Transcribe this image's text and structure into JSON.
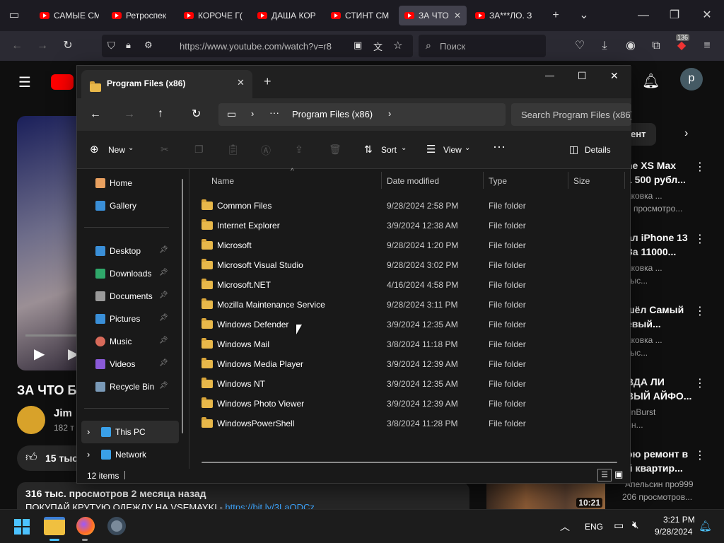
{
  "browser": {
    "tabs": [
      {
        "label": "САМЫЕ СМ"
      },
      {
        "label": "Ретроспек"
      },
      {
        "label": "КОРОЧЕ Г("
      },
      {
        "label": "ДАША КОР"
      },
      {
        "label": "СТИНТ СМ"
      },
      {
        "label": "ЗА ЧТО"
      },
      {
        "label": "ЗА***ЛО. З"
      }
    ],
    "url": "https://www.youtube.com/watch?v=r8",
    "search_placeholder": "Поиск",
    "badge_count": "136"
  },
  "youtube": {
    "avatar_letter": "p",
    "chip": "ент",
    "video_title": "ЗА ЧТО Б",
    "channel_name": "Jim",
    "subscribers": "182 т",
    "likes": "15 тыс",
    "views_line": "316 тыс. просмотров  2 месяца назад",
    "description_line": "ПОКУПАЙ КРУТУЮ ОДЕЖДУ НА VSEMAYKI - ",
    "description_link": "https://bit.ly/3LaQDCz",
    "thumb_duration": "10:21",
    "sidebar": [
      {
        "line1": "ne XS Max",
        "line2": "1 500 рубл...",
        "channel": "аковка ...",
        "meta": "н просмотро..."
      },
      {
        "line1": "ал iPhone 13",
        "line2": "За 11000...",
        "channel": "аковка ...",
        "meta": "тыс..."
      },
      {
        "line1": "шёл Самый",
        "line2": "евый...",
        "channel": "аковка ...",
        "meta": "тыс..."
      },
      {
        "line1": "ВДА ЛИ",
        "line2": "ВЫЙ АЙФО...",
        "channel": "enBurst",
        "meta": "лн..."
      },
      {
        "line1": "ою ремонт в",
        "line2": "й квартир...",
        "channel": "Апельсин про999",
        "meta": "206 просмотров..."
      }
    ]
  },
  "explorer": {
    "tab_title": "Program Files (x86)",
    "breadcrumb": "Program Files (x86)",
    "search_placeholder": "Search Program Files (x86)",
    "commands": {
      "new": "New",
      "sort": "Sort",
      "view": "View",
      "details": "Details"
    },
    "columns": {
      "name": "Name",
      "date": "Date modified",
      "type": "Type",
      "size": "Size"
    },
    "nav": {
      "home": "Home",
      "gallery": "Gallery",
      "desktop": "Desktop",
      "downloads": "Downloads",
      "documents": "Documents",
      "pictures": "Pictures",
      "music": "Music",
      "videos": "Videos",
      "recycle": "Recycle Bin",
      "thispc": "This PC",
      "network": "Network"
    },
    "files": [
      {
        "name": "Common Files",
        "date": "9/28/2024 2:58 PM",
        "type": "File folder"
      },
      {
        "name": "Internet Explorer",
        "date": "3/9/2024 12:38 AM",
        "type": "File folder"
      },
      {
        "name": "Microsoft",
        "date": "9/28/2024 1:20 PM",
        "type": "File folder"
      },
      {
        "name": "Microsoft Visual Studio",
        "date": "9/28/2024 3:02 PM",
        "type": "File folder"
      },
      {
        "name": "Microsoft.NET",
        "date": "4/16/2024 4:58 PM",
        "type": "File folder"
      },
      {
        "name": "Mozilla Maintenance Service",
        "date": "9/28/2024 3:11 PM",
        "type": "File folder"
      },
      {
        "name": "Windows Defender",
        "date": "3/9/2024 12:35 AM",
        "type": "File folder"
      },
      {
        "name": "Windows Mail",
        "date": "3/8/2024 11:18 PM",
        "type": "File folder"
      },
      {
        "name": "Windows Media Player",
        "date": "3/9/2024 12:39 AM",
        "type": "File folder"
      },
      {
        "name": "Windows NT",
        "date": "3/9/2024 12:35 AM",
        "type": "File folder"
      },
      {
        "name": "Windows Photo Viewer",
        "date": "3/9/2024 12:39 AM",
        "type": "File folder"
      },
      {
        "name": "WindowsPowerShell",
        "date": "3/8/2024 11:28 PM",
        "type": "File folder"
      }
    ],
    "status": "12 items"
  },
  "taskbar": {
    "lang": "ENG",
    "time": "3:21 PM",
    "date": "9/28/2024"
  }
}
